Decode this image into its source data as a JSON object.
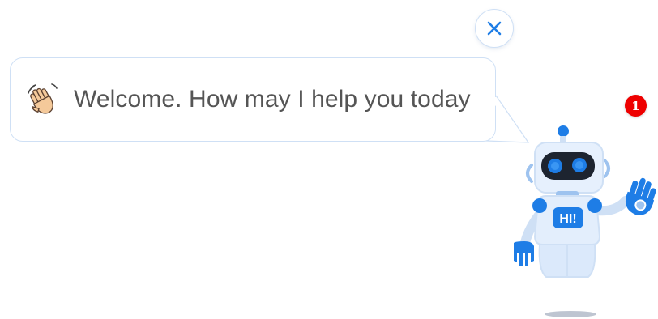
{
  "chat_widget": {
    "close_icon": "close-icon",
    "wave_icon": "waving-hand-emoji",
    "welcome_message": "Welcome. How may I help you today",
    "notification_count": "1",
    "robot_badge_text": "HI!",
    "colors": {
      "accent": "#1e7de6",
      "robot_body": "#e3eefc",
      "badge": "#ee0000",
      "bubble_border": "#cfe0f5",
      "text": "#555555"
    }
  }
}
